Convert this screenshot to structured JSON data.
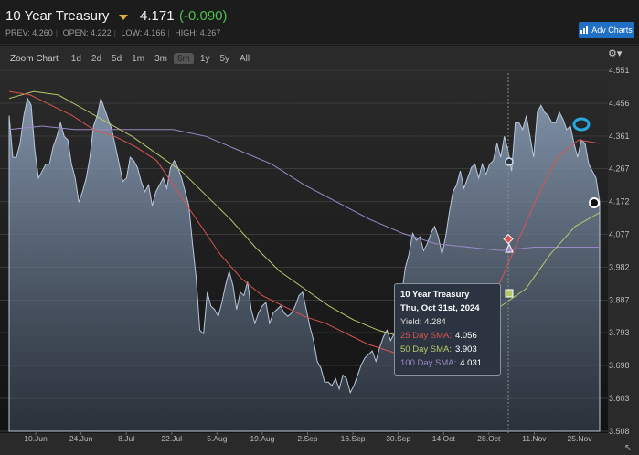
{
  "header": {
    "title": "10 Year Treasury",
    "price": "4.171",
    "change": "(-0.090)",
    "stats": [
      {
        "label": "PREV:",
        "value": "4.260"
      },
      {
        "label": "OPEN:",
        "value": "4.222"
      },
      {
        "label": "LOW:",
        "value": "4.166"
      },
      {
        "label": "HIGH:",
        "value": "4.267"
      }
    ],
    "adv_charts_label": "Adv Charts"
  },
  "zoom": {
    "label": "Zoom Chart",
    "options": [
      "1d",
      "2d",
      "5d",
      "1m",
      "3m",
      "6m",
      "1y",
      "5y",
      "All"
    ],
    "active": "6m"
  },
  "colors": {
    "yield": "#8fa3bd",
    "sma25": "#d9534f",
    "sma50": "#b7c96a",
    "sma100": "#9a89c7",
    "marker": "#29a8e0"
  },
  "chart_data": {
    "type": "area",
    "x_tick_labels": [
      "10.Jun",
      "24.Jun",
      "8.Jul",
      "22.Jul",
      "5.Aug",
      "19.Aug",
      "2.Sep",
      "16.Sep",
      "30.Sep",
      "14.Oct",
      "28.Oct",
      "11.Nov",
      "25.Nov"
    ],
    "y_tick_labels": [
      "4.551",
      "4.456",
      "4.361",
      "4.267",
      "4.172",
      "4.077",
      "3.982",
      "3.887",
      "3.793",
      "3.698",
      "3.603",
      "3.508"
    ],
    "ylim": [
      3.508,
      4.551
    ],
    "series": [
      {
        "name": "Yield",
        "values": [
          4.42,
          4.3,
          4.3,
          4.34,
          4.42,
          4.47,
          4.45,
          4.32,
          4.24,
          4.26,
          4.28,
          4.28,
          4.33,
          4.36,
          4.4,
          4.36,
          4.35,
          4.28,
          4.24,
          4.17,
          4.2,
          4.24,
          4.3,
          4.39,
          4.42,
          4.47,
          4.44,
          4.41,
          4.38,
          4.33,
          4.28,
          4.23,
          4.24,
          4.3,
          4.29,
          4.27,
          4.23,
          4.2,
          4.22,
          4.16,
          4.2,
          4.22,
          4.24,
          4.21,
          4.27,
          4.29,
          4.27,
          4.24,
          4.2,
          4.16,
          4.05,
          3.95,
          3.8,
          3.79,
          3.91,
          3.87,
          3.86,
          3.84,
          3.88,
          3.93,
          3.97,
          3.93,
          3.86,
          3.91,
          3.9,
          3.94,
          3.86,
          3.82,
          3.85,
          3.87,
          3.88,
          3.82,
          3.85,
          3.86,
          3.87,
          3.85,
          3.84,
          3.85,
          3.87,
          3.9,
          3.91,
          3.86,
          3.81,
          3.77,
          3.71,
          3.69,
          3.65,
          3.65,
          3.64,
          3.66,
          3.63,
          3.67,
          3.66,
          3.62,
          3.64,
          3.67,
          3.7,
          3.72,
          3.73,
          3.74,
          3.71,
          3.75,
          3.78,
          3.8,
          3.77,
          3.79,
          3.81,
          3.9,
          3.98,
          4.02,
          4.08,
          4.06,
          4.07,
          4.03,
          4.05,
          4.08,
          4.1,
          4.07,
          4.02,
          4.07,
          4.14,
          4.2,
          4.22,
          4.26,
          4.21,
          4.24,
          4.27,
          4.28,
          4.24,
          4.28,
          4.25,
          4.28,
          4.29,
          4.34,
          4.3,
          4.36,
          4.32,
          4.26,
          4.4,
          4.4,
          4.38,
          4.42,
          4.36,
          4.3,
          4.43,
          4.45,
          4.43,
          4.42,
          4.4,
          4.4,
          4.43,
          4.41,
          4.38,
          4.39,
          4.34,
          4.3,
          4.35,
          4.34,
          4.28,
          4.26,
          4.24,
          4.171
        ]
      },
      {
        "name": "25 Day SMA",
        "values": [
          4.49,
          4.48,
          4.45,
          4.42,
          4.38,
          4.36,
          4.33,
          4.29,
          4.2,
          4.11,
          4.02,
          3.95,
          3.9,
          3.87,
          3.84,
          3.82,
          3.79,
          3.76,
          3.74,
          3.72,
          3.72,
          3.74,
          3.8,
          3.9,
          4.04,
          4.18,
          4.3,
          4.35,
          4.34
        ]
      },
      {
        "name": "50 Day SMA",
        "values": [
          4.47,
          4.49,
          4.48,
          4.44,
          4.4,
          4.36,
          4.31,
          4.26,
          4.19,
          4.12,
          4.04,
          3.97,
          3.92,
          3.87,
          3.83,
          3.8,
          3.78,
          3.77,
          3.77,
          3.8,
          3.87,
          3.92,
          4.02,
          4.1,
          4.14
        ]
      },
      {
        "name": "100 Day SMA",
        "values": [
          4.38,
          4.39,
          4.38,
          4.38,
          4.38,
          4.38,
          4.36,
          4.32,
          4.28,
          4.22,
          4.17,
          4.12,
          4.08,
          4.05,
          4.04,
          4.03,
          4.04,
          4.04,
          4.04
        ]
      }
    ]
  },
  "tooltip": {
    "title": "10 Year Treasury",
    "date": "Thu, Oct 31st, 2024",
    "yield_label": "Yield:",
    "yield_value": "4.284",
    "sma25_label": "25 Day SMA:",
    "sma25_value": "4.056",
    "sma50_label": "50 Day SMA:",
    "sma50_value": "3.903",
    "sma100_label": "100 Day SMA:",
    "sma100_value": "4.031"
  }
}
